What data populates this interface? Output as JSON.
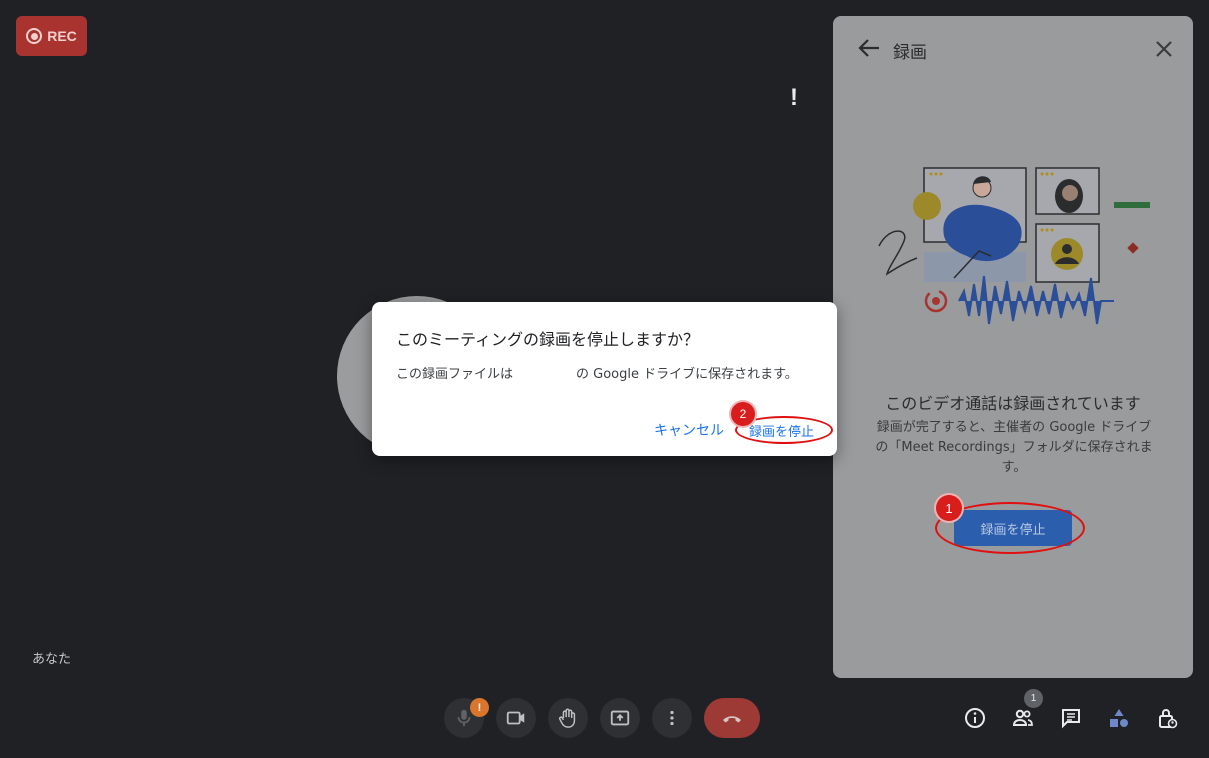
{
  "rec_badge": {
    "label": "REC"
  },
  "self_tile": {
    "name": "あなた"
  },
  "panel": {
    "title": "録画",
    "heading": "このビデオ通話は録画されています",
    "description": "録画が完了すると、主催者の Google ドライブの「Meet Recordings」フォルダに保存されます。",
    "stop_button": "録画を停止",
    "annotation_number": "1"
  },
  "dialog": {
    "title": "このミーティングの録画を停止しますか？",
    "body_prefix": "この録画ファイルは",
    "body_suffix": "の Google ドライブに保存されます。",
    "cancel_label": "キャンセル",
    "stop_label": "録画を停止",
    "annotation_number": "2"
  },
  "controls": {
    "mic_warning": "!",
    "people_count": "1"
  },
  "colors": {
    "background": "#202124",
    "rec": "#a8332f",
    "accent": "#1a73e8",
    "annotation": "#e01010"
  }
}
